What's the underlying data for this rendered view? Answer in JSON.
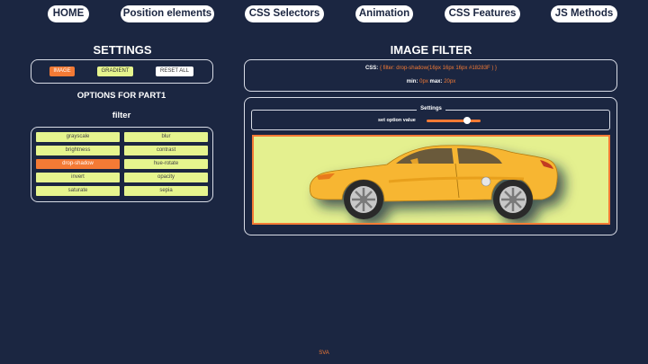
{
  "nav": {
    "home": "HOME",
    "position": "Position elements",
    "selectors": "CSS Selectors",
    "animation": "Animation",
    "features": "CSS Features",
    "js": "JS Methods"
  },
  "settings": {
    "title": "SETTINGS",
    "modes": {
      "image": "IMAGE",
      "gradient": "GRADIENT",
      "reset": "RESET ALL"
    },
    "options_title": "OPTIONS FOR PART1",
    "filter_title": "filter",
    "filters": [
      "grayscale",
      "blur",
      "brightness",
      "contrast",
      "drop-shadow",
      "hue-rotate",
      "invert",
      "opacity",
      "saturate",
      "sepia"
    ],
    "active_filter": "drop-shadow"
  },
  "image_filter": {
    "title": "IMAGE FILTER",
    "css_label": "CSS:",
    "css_value": "{ filter: drop-shadow(16px 16px 16px #18283F ) }",
    "min_label": "min:",
    "min_value": "0px",
    "max_label": "max:",
    "max_value": "20px",
    "settings_legend": "Settings",
    "slider_label": "set option value",
    "slider_fraction": 0.7
  },
  "footer": {
    "text": "SVA"
  },
  "colors": {
    "background": "#1b2641",
    "accent": "#f47a35",
    "filter_button": "#e6f58e",
    "image_background": "#e4f08f",
    "car_body": "#f7b631"
  }
}
